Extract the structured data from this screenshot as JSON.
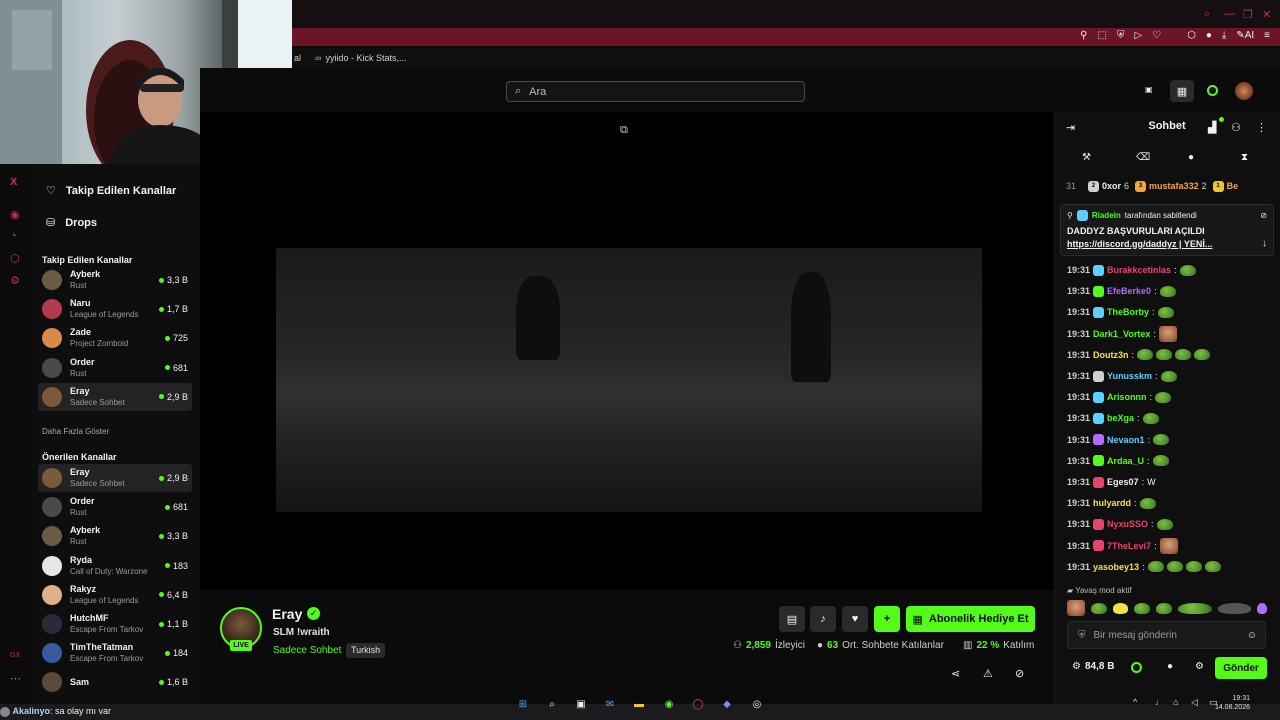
{
  "browser": {
    "bookmarks": [
      "al",
      "yyiido - Kick Stats,..."
    ],
    "address_icons": [
      "pin-icon",
      "screenshot-icon",
      "shield-icon",
      "send-icon",
      "heart-icon",
      "extensions-icon",
      "profile-icon",
      "download-icon",
      "ai-icon",
      "menu-icon"
    ],
    "ai_label": "AI"
  },
  "header": {
    "search_placeholder": "Ara"
  },
  "sidebar": {
    "nav": [
      {
        "label": "Takip Edilen Kanallar",
        "icon": "heart-icon"
      },
      {
        "label": "Drops",
        "icon": "drops-icon"
      }
    ],
    "followed_title": "Takip Edilen Kanallar",
    "followed": [
      {
        "name": "Ayberk",
        "category": "Rust",
        "viewers": "3,3 B",
        "color": "#6b5a44"
      },
      {
        "name": "Naru",
        "category": "League of Legends",
        "viewers": "1,7 B",
        "color": "#b23a4a"
      },
      {
        "name": "Zade",
        "category": "Project Zomboid",
        "viewers": "725",
        "color": "#d98a4a"
      },
      {
        "name": "Order",
        "category": "Rust",
        "viewers": "681",
        "color": "#4a4a4a"
      },
      {
        "name": "Eray",
        "category": "Sadece Sohbet",
        "viewers": "2,9 B",
        "color": "#7a5a3a",
        "active": true
      }
    ],
    "show_more": "Daha Fazla Göster",
    "recommended_title": "Önerilen Kanallar",
    "recommended": [
      {
        "name": "Eray",
        "category": "Sadece Sohbet",
        "viewers": "2,9 B",
        "color": "#7a5a3a",
        "active": true
      },
      {
        "name": "Order",
        "category": "Rust",
        "viewers": "681",
        "color": "#4a4a4a"
      },
      {
        "name": "Ayberk",
        "category": "Rust",
        "viewers": "3,3 B",
        "color": "#6b5a44"
      },
      {
        "name": "Ryda",
        "category": "Call of Duty: Warzone",
        "viewers": "183",
        "color": "#e6e6e6"
      },
      {
        "name": "Rakyz",
        "category": "League of Legends",
        "viewers": "6,4 B",
        "color": "#e0b088"
      },
      {
        "name": "HutchMF",
        "category": "Escape From Tarkov",
        "viewers": "1,1 B",
        "color": "#2a2a3a"
      },
      {
        "name": "TimTheTatman",
        "category": "Escape From Tarkov",
        "viewers": "184",
        "color": "#3a5aa0"
      },
      {
        "name": "Sam",
        "category": "",
        "viewers": "1,6 B",
        "color": "#5a4a3a"
      }
    ]
  },
  "stream": {
    "name": "Eray",
    "title": "SLM !wraith",
    "category": "Sadece Sohbet",
    "tag": "Turkish",
    "live_label": "LIVE",
    "subscribe_label": "Abonelik Hediye Et",
    "viewers": "2,859",
    "viewers_label": "İzleyici",
    "avg_chatters": "63",
    "avg_chatters_label": "Ort. Sohbete Katılanlar",
    "participation": "22 %",
    "participation_label": "Katılım"
  },
  "chat": {
    "title": "Sohbet",
    "leaderboard": [
      {
        "rank": "31",
        "name": "",
        "value": ""
      },
      {
        "rank": "",
        "name": "0xor",
        "value": "6",
        "color": "#f0f0f0"
      },
      {
        "rank": "",
        "name": "mustafa332",
        "value": "2",
        "color": "#f4a340"
      },
      {
        "rank": "",
        "name": "Be",
        "value": "",
        "color": "#f4a340"
      }
    ],
    "pinned": {
      "pinner": "Riadein",
      "pinned_by_text": "tarafından sabitlendi",
      "line1": "DADDYZ BAŞVURULARI AÇILDI",
      "line2": "https://discord.gg/daddyz | YENİ..."
    },
    "messages": [
      {
        "time": "19:31",
        "user": "Burakkcetinlas",
        "color": "#e8436b",
        "text": "",
        "badge": "#5ad0ff",
        "emotes": 1
      },
      {
        "time": "19:31",
        "user": "EfeBerke0",
        "color": "#b06bff",
        "text": "",
        "badge": "#53fc18",
        "emotes": 1
      },
      {
        "time": "19:31",
        "user": "TheBorby",
        "color": "#53fc18",
        "text": "",
        "badge": "#5ad0ff",
        "emotes": 1
      },
      {
        "time": "19:31",
        "user": "Dark1_Vortex",
        "color": "#53fc18",
        "text": "",
        "badge": "",
        "emotes": 0,
        "face": true
      },
      {
        "time": "19:31",
        "user": "Doutz3n",
        "color": "#f4e04a",
        "text": "",
        "badge": "",
        "emotes": 4
      },
      {
        "time": "19:31",
        "user": "Yunusskm",
        "color": "#5ad0ff",
        "text": "",
        "badge": "#cfcfcf",
        "emotes": 1
      },
      {
        "time": "19:31",
        "user": "Arisonnn",
        "color": "#53fc18",
        "text": "",
        "badge": "#5ad0ff",
        "emotes": 1
      },
      {
        "time": "19:31",
        "user": "beXga",
        "color": "#53fc18",
        "text": "",
        "badge": "#5ad0ff",
        "emotes": 1
      },
      {
        "time": "19:31",
        "user": "Nevaon1",
        "color": "#5ad0ff",
        "text": "",
        "badge": "#b06bff",
        "emotes": 1
      },
      {
        "time": "19:31",
        "user": "Ardaa_U",
        "color": "#53fc18",
        "text": "",
        "badge": "#53fc18",
        "emotes": 1
      },
      {
        "time": "19:31",
        "user": "Eges07",
        "color": "#f0f0f0",
        "text": "W",
        "badge": "#e8436b",
        "emotes": 0
      },
      {
        "time": "19:31",
        "user": "hulyardd",
        "color": "#f4e04a",
        "text": "",
        "badge": "",
        "emotes": 1
      },
      {
        "time": "19:31",
        "user": "NyxuSSO",
        "color": "#e8436b",
        "text": "",
        "badge": "#e8436b",
        "emotes": 1
      },
      {
        "time": "19:31",
        "user": "7TheLevi7",
        "color": "#e8436b",
        "text": "",
        "badge": "#e8436b",
        "emotes": 0,
        "face": true
      },
      {
        "time": "19:31",
        "user": "yasobey13",
        "color": "#f4e04a",
        "text": "",
        "badge": "",
        "emotes": 4
      }
    ],
    "slow_mode": "Yavaş mod aktif",
    "input_placeholder": "Bir mesaj gönderin",
    "points": "84,8 B",
    "send_label": "Gönder"
  },
  "taskbar": {
    "toast_user": "Akalinyo",
    "toast_text": ": sa olay mı var",
    "time": "19:31",
    "date": "14.08.2026"
  },
  "colors": {
    "accent": "#53fc18",
    "browser_red": "#6b1526",
    "background": "#0b0b0c"
  }
}
